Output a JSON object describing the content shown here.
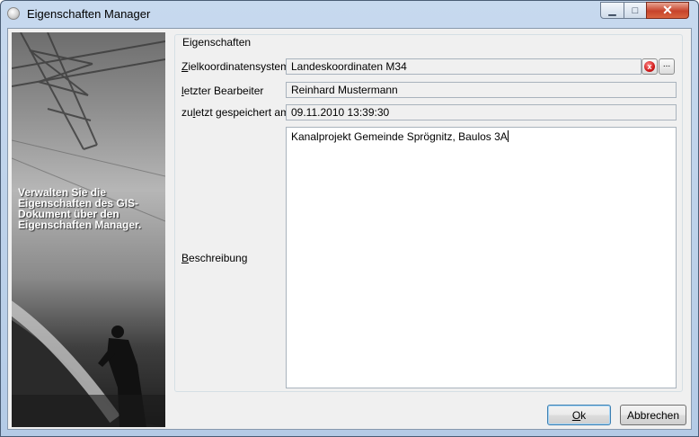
{
  "window": {
    "title": "Eigenschaften Manager",
    "controls": {
      "minimize": "▁",
      "maximize": "□",
      "close": "✕"
    }
  },
  "banner": {
    "text": "Verwalten Sie die Eigenschaften des GIS-Dokument über den Eigenschaften Manager."
  },
  "group": {
    "legend": "Eigenschaften"
  },
  "fields": {
    "zielkoordinatensystem": {
      "label_accel": "Z",
      "label_rest": "ielkoordinatensystem",
      "value": "Landeskoordinaten M34"
    },
    "letzter_bearbeiter": {
      "label_accel": "l",
      "label_rest": "etzter Bearbeiter",
      "value": "Reinhard Mustermann"
    },
    "zuletzt_gespeichert": {
      "label_pre": "zu",
      "label_accel": "l",
      "label_rest": "etzt gespeichert am",
      "value": "09.11.2010 13:39:30"
    },
    "beschreibung": {
      "label_accel": "B",
      "label_rest": "eschreibung",
      "value": "Kanalprojekt Gemeinde Sprögnitz, Baulos 3A"
    }
  },
  "buttons": {
    "ok": {
      "accel": "O",
      "rest": "k"
    },
    "cancel": {
      "label": "Abbrechen"
    },
    "clear_icon": "x",
    "browse_label": "..."
  },
  "colors": {
    "accent": "#3c7fb1",
    "close_red": "#c7432b",
    "title_bar": "#b4cbe6"
  }
}
